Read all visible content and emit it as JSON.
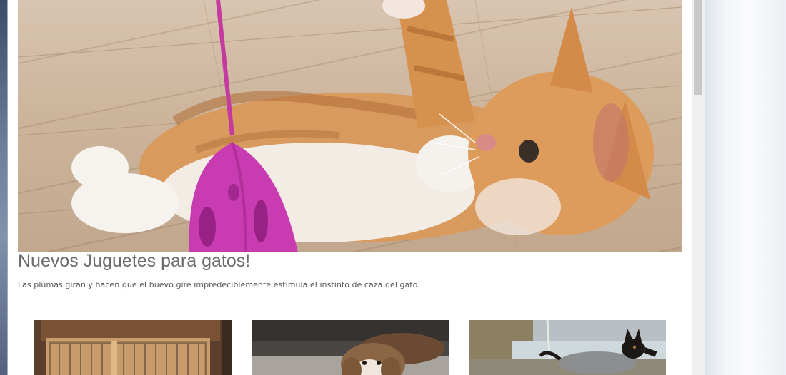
{
  "hero": {
    "title": "Nuevos Juguetes para gatos!",
    "description": "Las plumas giran y hacen que el huevo gire impredeciblemente.estimula el instinto de caza del gato.",
    "image_icon": "cat-photo"
  },
  "thumbnails": [
    {
      "icon": "dog-crate-photo"
    },
    {
      "icon": "beagle-photo"
    },
    {
      "icon": "dog-coat-photo"
    }
  ],
  "colors": {
    "title": "#6b6b6b",
    "text": "#555555",
    "background": "#ffffff"
  }
}
